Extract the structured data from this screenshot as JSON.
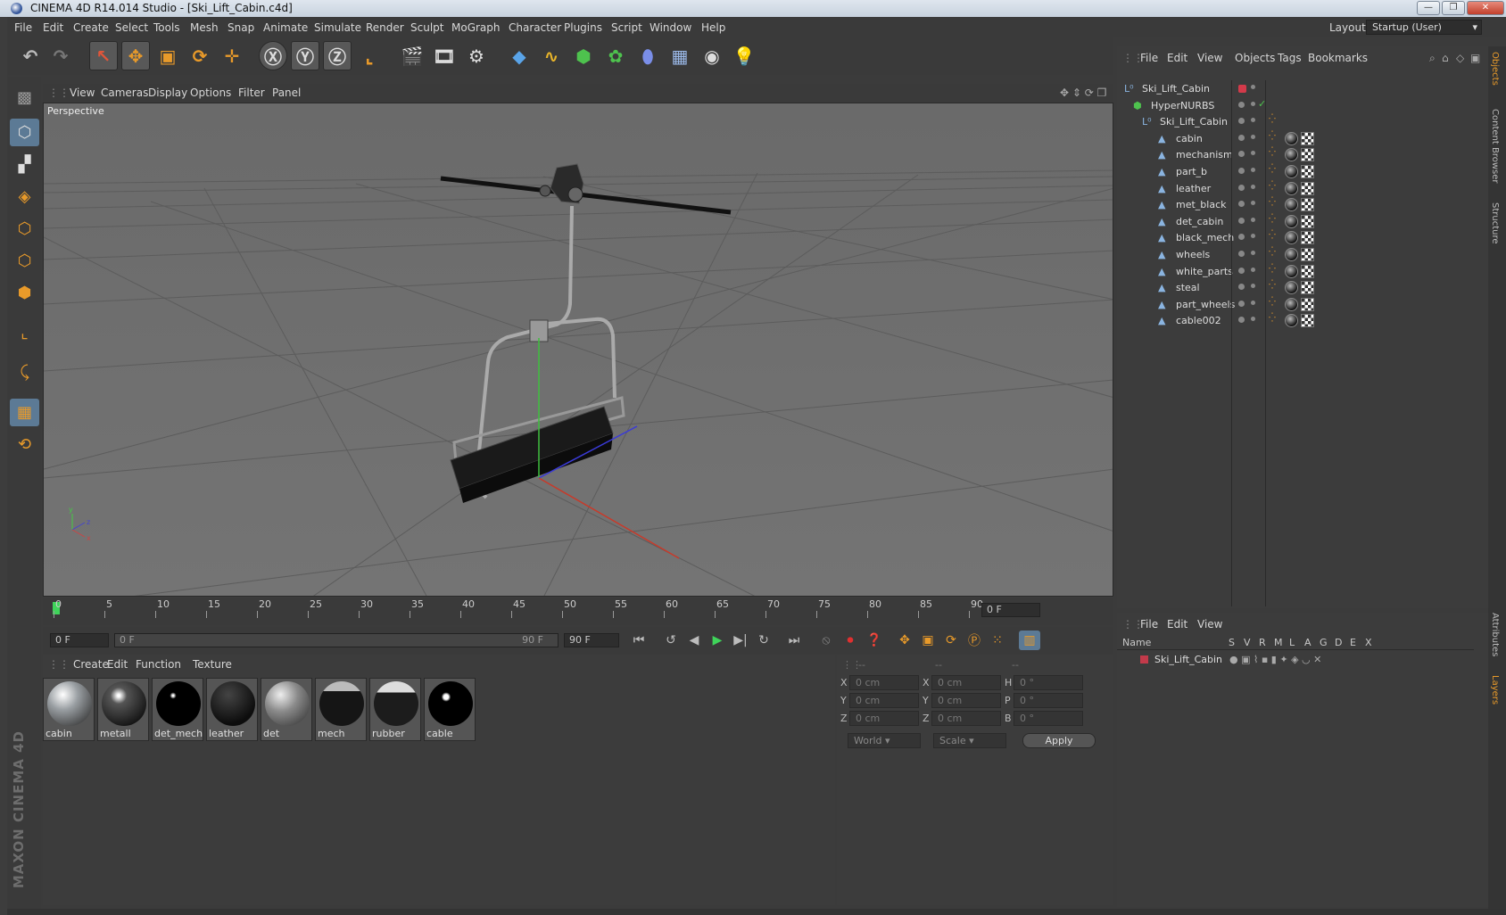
{
  "window": {
    "title": "CINEMA 4D R14.014 Studio - [Ski_Lift_Cabin.c4d]"
  },
  "menu": [
    "File",
    "Edit",
    "Create",
    "Select",
    "Tools",
    "Mesh",
    "Snap",
    "Animate",
    "Simulate",
    "Render",
    "Sculpt",
    "MoGraph",
    "Character",
    "Plugins",
    "Script",
    "Window",
    "Help"
  ],
  "layout": {
    "label": "Layout:",
    "value": "Startup (User)"
  },
  "viewport": {
    "menu": [
      "View",
      "Cameras",
      "Display",
      "Options",
      "Filter",
      "Panel"
    ],
    "label": "Perspective"
  },
  "timeline": {
    "ticks": [
      "0",
      "5",
      "10",
      "15",
      "20",
      "25",
      "30",
      "35",
      "40",
      "45",
      "50",
      "55",
      "60",
      "65",
      "70",
      "75",
      "80",
      "85",
      "90"
    ],
    "current_frame": "0 F",
    "start": "0 F",
    "range_start": "0 F",
    "range_end": "90 F",
    "end": "90 F"
  },
  "materials": {
    "menu": [
      "Create",
      "Edit",
      "Function",
      "Texture"
    ],
    "items": [
      {
        "name": "cabin"
      },
      {
        "name": "metall"
      },
      {
        "name": "det_mech"
      },
      {
        "name": "leather"
      },
      {
        "name": "det"
      },
      {
        "name": "mech"
      },
      {
        "name": "rubber"
      },
      {
        "name": "cable"
      }
    ]
  },
  "coords": {
    "headers": [
      "--",
      "--",
      "--"
    ],
    "rows": [
      {
        "a": "X",
        "av": "0 cm",
        "b": "X",
        "bv": "0 cm",
        "c": "H",
        "cv": "0 °"
      },
      {
        "a": "Y",
        "av": "0 cm",
        "b": "Y",
        "bv": "0 cm",
        "c": "P",
        "cv": "0 °"
      },
      {
        "a": "Z",
        "av": "0 cm",
        "b": "Z",
        "bv": "0 cm",
        "c": "B",
        "cv": "0 °"
      }
    ],
    "world": "World",
    "scale": "Scale",
    "apply": "Apply"
  },
  "objects": {
    "menu": [
      "File",
      "Edit",
      "View",
      "Objects",
      "Tags",
      "Bookmarks"
    ],
    "tree": [
      {
        "name": "Ski_Lift_Cabin",
        "level": 0,
        "icon": "null-icon"
      },
      {
        "name": "HyperNURBS",
        "level": 1,
        "icon": "hypernurbs-icon"
      },
      {
        "name": "Ski_Lift_Cabin",
        "level": 2,
        "icon": "null-icon"
      },
      {
        "name": "cabin",
        "level": 3,
        "icon": "polygon-icon"
      },
      {
        "name": "mechanism",
        "level": 3,
        "icon": "polygon-icon"
      },
      {
        "name": "part_b",
        "level": 3,
        "icon": "polygon-icon"
      },
      {
        "name": "leather",
        "level": 3,
        "icon": "polygon-icon"
      },
      {
        "name": "met_black",
        "level": 3,
        "icon": "polygon-icon"
      },
      {
        "name": "det_cabin",
        "level": 3,
        "icon": "polygon-icon"
      },
      {
        "name": "black_mech",
        "level": 3,
        "icon": "polygon-icon"
      },
      {
        "name": "wheels",
        "level": 3,
        "icon": "polygon-icon"
      },
      {
        "name": "white_parts",
        "level": 3,
        "icon": "polygon-icon"
      },
      {
        "name": "steal",
        "level": 3,
        "icon": "polygon-icon"
      },
      {
        "name": "part_wheels",
        "level": 3,
        "icon": "polygon-icon"
      },
      {
        "name": "cable002",
        "level": 3,
        "icon": "polygon-icon"
      }
    ]
  },
  "layers": {
    "menu": [
      "File",
      "Edit",
      "View"
    ],
    "columns": [
      "Name",
      "S",
      "V",
      "R",
      "M",
      "L",
      "A",
      "G",
      "D",
      "E",
      "X"
    ],
    "rows": [
      {
        "name": "Ski_Lift_Cabin"
      }
    ]
  },
  "side_tabs": [
    "Objects",
    "Content Browser",
    "Structure",
    "Attributes",
    "Layers"
  ],
  "brand": "MAXON CINEMA 4D"
}
